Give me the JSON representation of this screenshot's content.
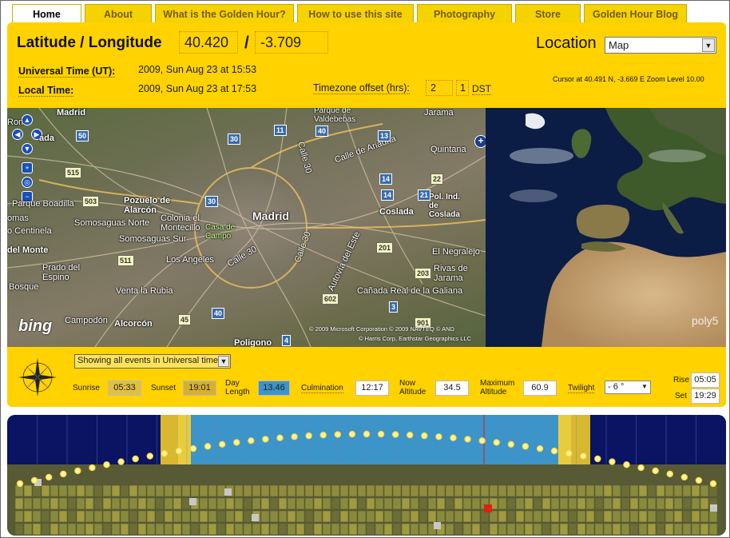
{
  "tabs": [
    {
      "label": "Home",
      "active": true
    },
    {
      "label": "About",
      "active": false
    },
    {
      "label": "What is the Golden Hour?",
      "active": false
    },
    {
      "label": "How to use this site",
      "active": false
    },
    {
      "label": "Photography",
      "active": false
    },
    {
      "label": "Store",
      "active": false
    },
    {
      "label": "Golden Hour Blog",
      "active": false
    }
  ],
  "header": {
    "latlon_label": "Latitude / Longitude",
    "latitude": "40.420",
    "slash": "/",
    "longitude": "-3.709",
    "location_label": "Location",
    "location_value": "Map",
    "ut_label": "Universal Time (UT):",
    "ut_value": "2009, Sun Aug 23 at 15:53",
    "local_label": "Local Time:",
    "local_value": "2009, Sun Aug 23 at 17:53",
    "tz_label": "Timezone offset (hrs):",
    "tz_offset": "2",
    "dst_value": "1",
    "dst_label": "DST",
    "cursor_info": "Cursor at 40.491 N, -3.669 E Zoom Level 10.00"
  },
  "map": {
    "labels": {
      "madrid_top": "Madrid",
      "madrid": "Madrid",
      "pozuelo": "Pozuelo de Alarcón",
      "somosaguas_n": "Somosaguas Norte",
      "somosaguas_s": "Somosaguas Sur",
      "colonia": "Colonia el Montecillo",
      "casa_campo": "Casa de Campo",
      "parque_boadilla": "Parque Boadilla",
      "centinela": "o Centinela",
      "del_monte": "del Monte",
      "prado": "Prado del Espino",
      "bosque": "Bosque",
      "venta_rubia": "Venta la Rubia",
      "los_angeles": "Los Angeles",
      "alcorcon": "Alcorcón",
      "campodon": "Campodón",
      "poligono": "Poligono",
      "coslada": "Coslada",
      "pol_coslada": "Pol. Ind. de Coslada",
      "el_negralejo": "El Negralejo",
      "rivas": "Rivas de Jarama",
      "canada": "Cañada Real de la Galiana",
      "jarama": "Jarama",
      "quintana": "Quintana",
      "valdebebas": "Parque de Valdebebas",
      "calle_ariadna": "Calle de Ariadna",
      "calle30a": "Calle 30",
      "calle30b": "Calle 30",
      "calle30c": "Calle 30",
      "autovia": "Autovía del Este",
      "ronda": "Ron",
      "ada": "ada",
      "omas": "omas"
    },
    "shields": [
      "50",
      "30",
      "40",
      "11",
      "13",
      "14",
      "22",
      "21",
      "30",
      "503",
      "515",
      "511",
      "201",
      "203",
      "602",
      "3",
      "901",
      "40",
      "45",
      "4",
      "14"
    ],
    "bing": "bing",
    "copyright1": "© 2009 Microsoft Corporation   © 2009 NAVTEQ   © AND",
    "copyright2": "© Harris Corp, Earthstar Geographics LLC",
    "globe_logo": "poly5"
  },
  "events": {
    "mode_select": "Showing all events in Universal time",
    "sunrise_label": "Sunrise",
    "sunrise": "05:33",
    "sunset_label": "Sunset",
    "sunset": "19:01",
    "day_length_label": "Day Length",
    "day_length": "13.46",
    "culmination_label": "Culmination",
    "culmination": "12:17",
    "now_alt_label": "Now Altitude",
    "now_alt": "34.5",
    "max_alt_label": "Maximum Altitude",
    "max_alt": "60.9",
    "twilight_label": "Twilight",
    "twilight": "- 6 °",
    "rise_label": "Rise",
    "rise": "05:05",
    "set_label": "Set",
    "set": "19:29"
  },
  "colors": {
    "accent": "#ffd200",
    "night": "#0a1462",
    "day": "#3c94c8",
    "golden": "#d8b830",
    "ground": "#575a34"
  }
}
